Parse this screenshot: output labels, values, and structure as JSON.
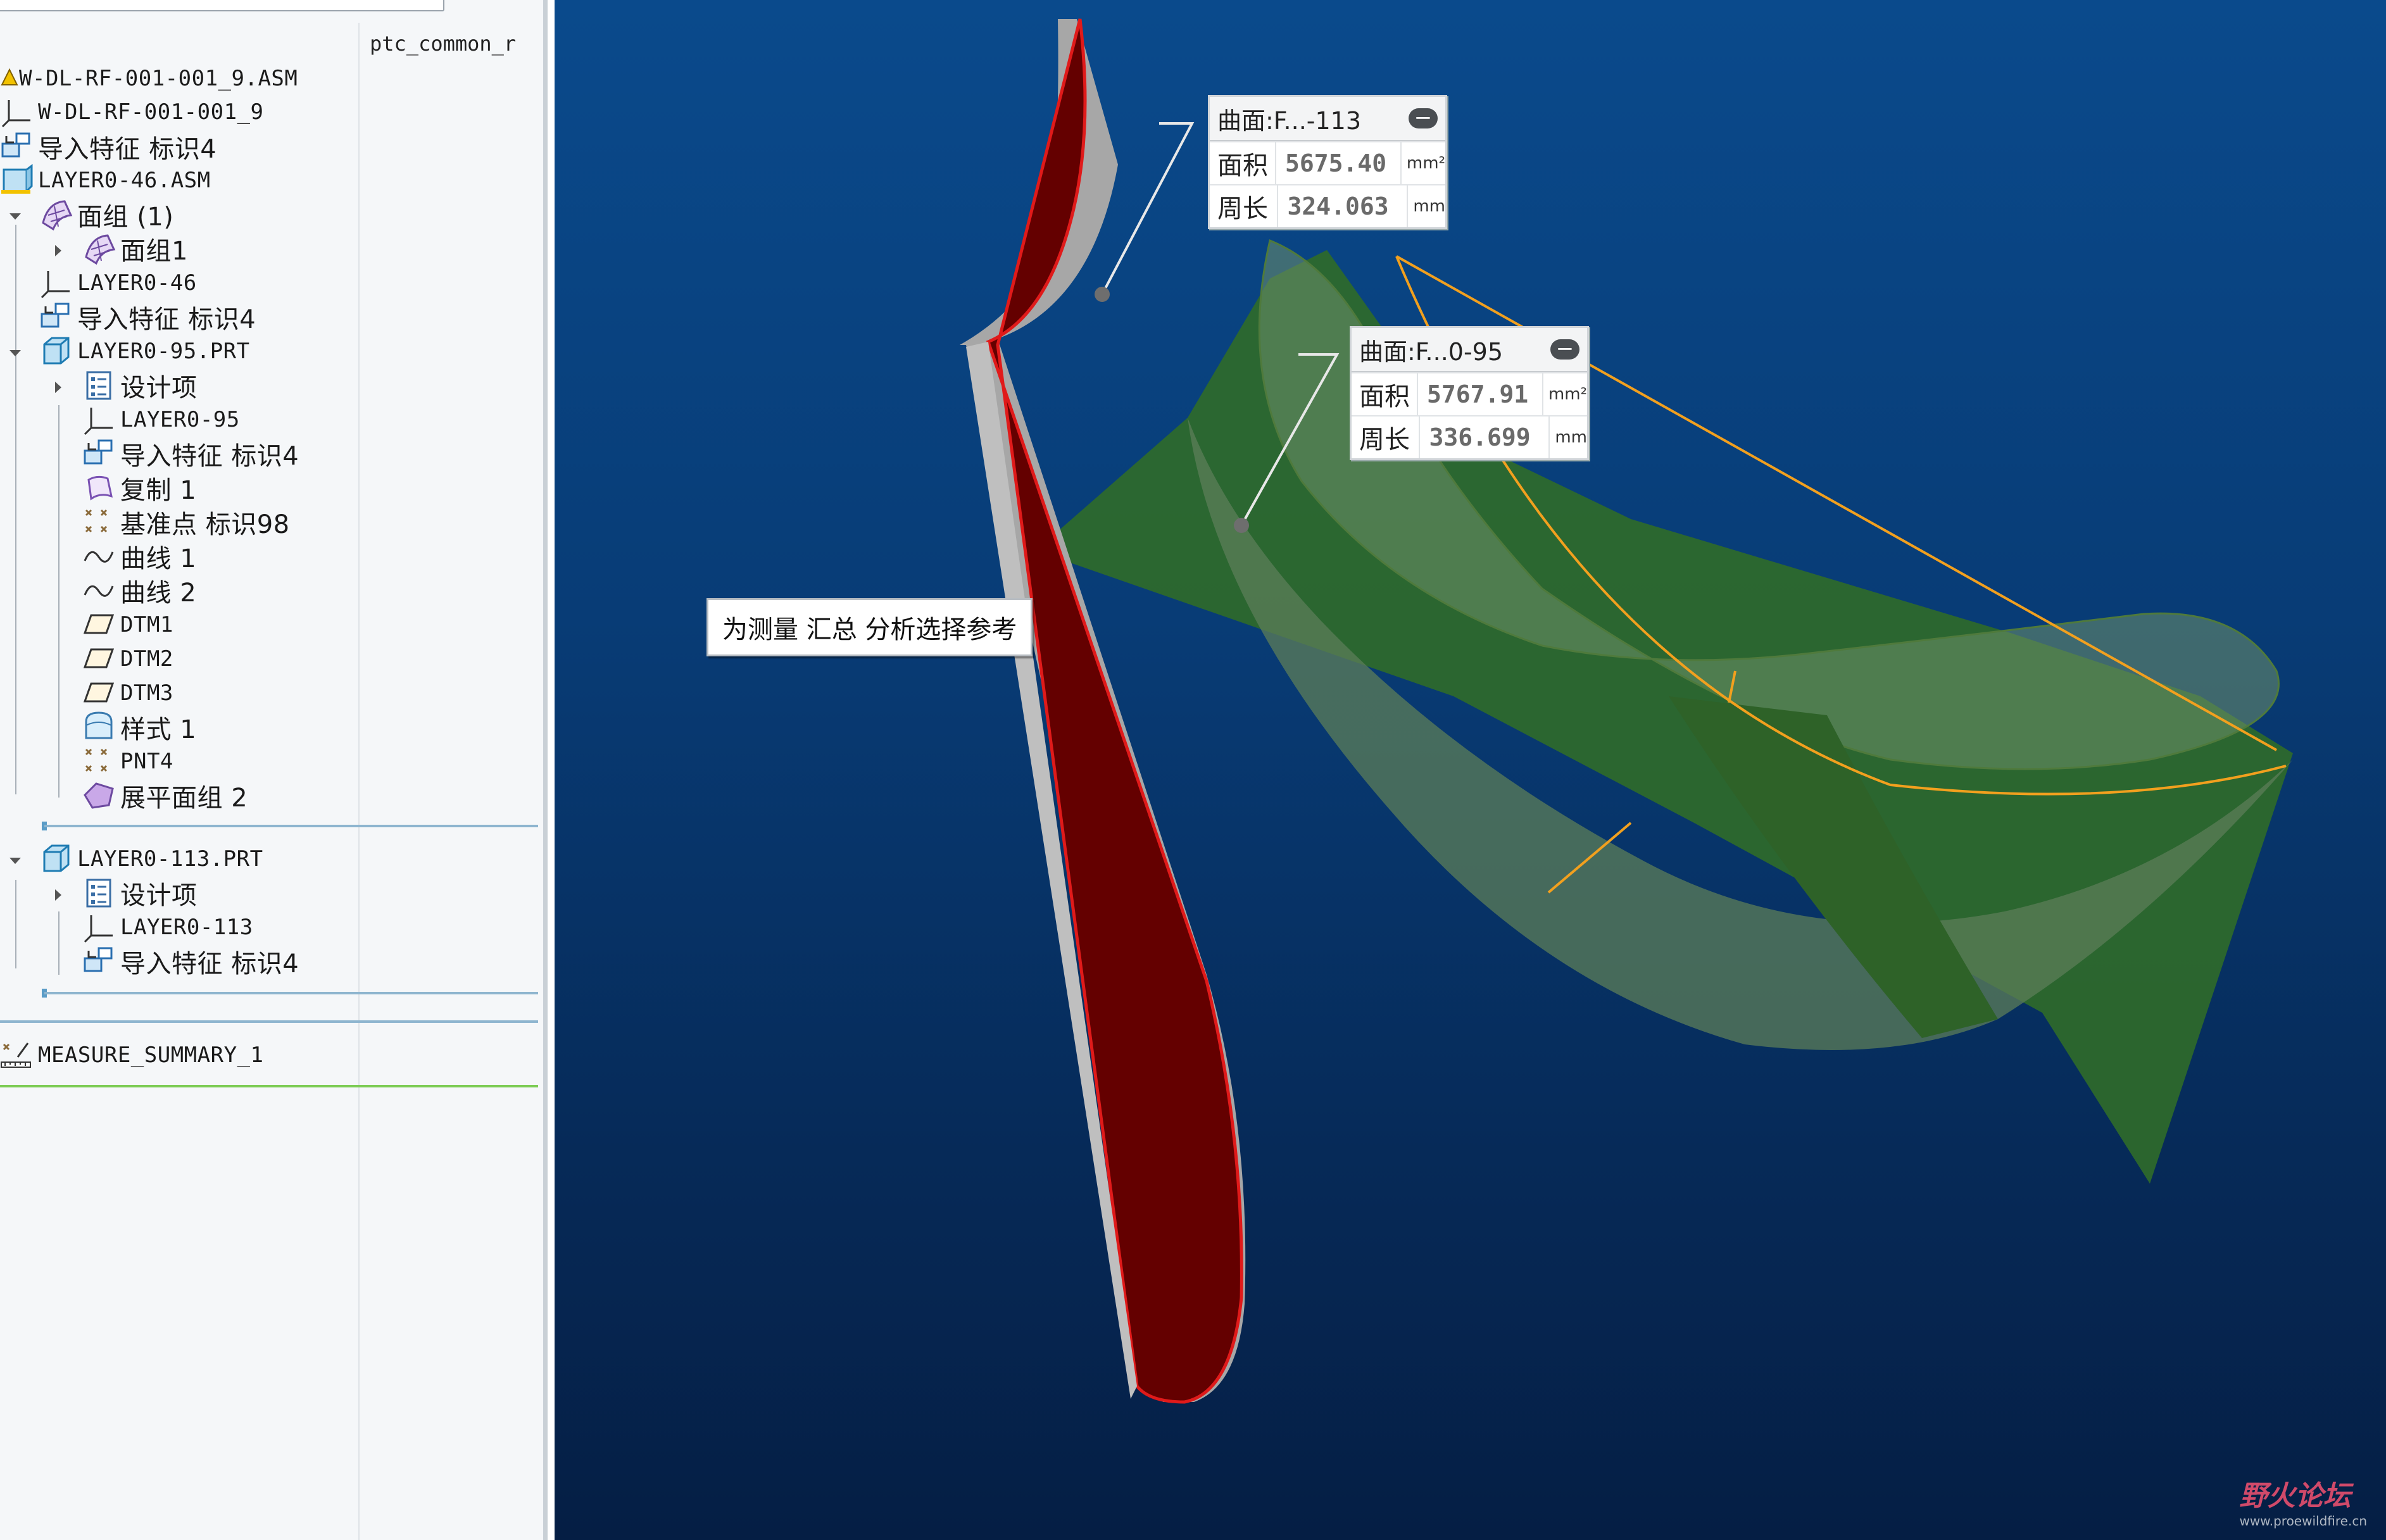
{
  "tree": {
    "column_header": "ptc_common_r",
    "items": [
      {
        "label": "W-DL-RF-001-001_9.ASM",
        "icon": "warning-assembly-icon"
      },
      {
        "label": "W-DL-RF-001-001_9",
        "icon": "coordinate-system-icon"
      },
      {
        "label": "导入特征 标识4",
        "icon": "import-feature-icon"
      },
      {
        "label": "LAYER0-46.ASM",
        "icon": "assembly-icon"
      },
      {
        "label": "面组 (1)",
        "icon": "quilt-icon"
      },
      {
        "label": "面组1",
        "icon": "quilt-icon"
      },
      {
        "label": "LAYER0-46",
        "icon": "coordinate-system-icon"
      },
      {
        "label": "导入特征 标识4",
        "icon": "import-feature-icon"
      },
      {
        "label": "LAYER0-95.PRT",
        "icon": "part-icon"
      },
      {
        "label": "设计项",
        "icon": "design-items-icon"
      },
      {
        "label": "LAYER0-95",
        "icon": "coordinate-system-icon"
      },
      {
        "label": "导入特征 标识4",
        "icon": "import-feature-icon"
      },
      {
        "label": "复制 1",
        "icon": "copy-icon"
      },
      {
        "label": "基准点 标识98",
        "icon": "datum-point-icon"
      },
      {
        "label": "曲线 1",
        "icon": "curve-icon"
      },
      {
        "label": "曲线 2",
        "icon": "curve-icon"
      },
      {
        "label": "DTM1",
        "icon": "datum-plane-icon"
      },
      {
        "label": "DTM2",
        "icon": "datum-plane-icon"
      },
      {
        "label": "DTM3",
        "icon": "datum-plane-icon"
      },
      {
        "label": "样式 1",
        "icon": "style-icon"
      },
      {
        "label": "PNT4",
        "icon": "datum-point-icon"
      },
      {
        "label": "展平面组 2",
        "icon": "flatten-quilt-icon"
      },
      {
        "label": "LAYER0-113.PRT",
        "icon": "part-icon"
      },
      {
        "label": "设计项",
        "icon": "design-items-icon"
      },
      {
        "label": "LAYER0-113",
        "icon": "coordinate-system-icon"
      },
      {
        "label": "导入特征 标识4",
        "icon": "import-feature-icon"
      },
      {
        "label": "MEASURE_SUMMARY_1",
        "icon": "measure-icon"
      }
    ]
  },
  "viewport": {
    "callouts": [
      {
        "title": "曲面:F...-113",
        "minimize": "−",
        "area_label": "面积",
        "area_value": "5675.40",
        "area_unit": "mm²",
        "perimeter_label": "周长",
        "perimeter_value": "324.063",
        "perimeter_unit": "mm"
      },
      {
        "title": "曲面:F...0-95",
        "minimize": "−",
        "area_label": "面积",
        "area_value": "5767.91",
        "area_unit": "mm²",
        "perimeter_label": "周长",
        "perimeter_value": "336.699",
        "perimeter_unit": "mm"
      }
    ],
    "tooltip": "为测量 汇总 分析选择参考",
    "watermark": {
      "brand": "野火论坛",
      "url": "www.proewildfire.cn"
    },
    "colors": {
      "red_surface": "#640000",
      "green_surface": "#2f6a2a",
      "measure_curve": "#f2a01e",
      "background_top": "#0a4a8c",
      "background_bottom": "#051e44"
    }
  }
}
